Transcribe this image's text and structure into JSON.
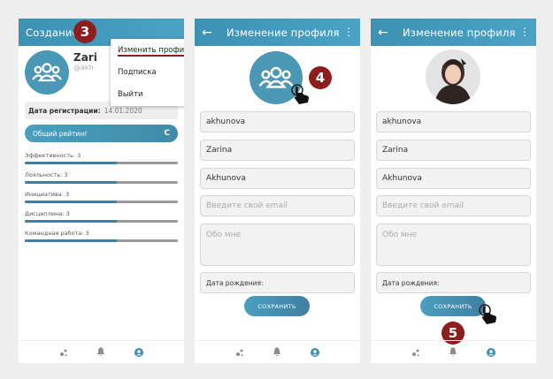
{
  "panel1": {
    "header_title": "Создание",
    "name": "Zari",
    "handle": "@akh",
    "reg_label": "Дата регистрации:",
    "reg_value": "14.01.2020",
    "rating_label": "Общий рейтинг",
    "rating_grade": "C",
    "metrics": [
      {
        "label": "Эффективность: 3",
        "value": 0.6
      },
      {
        "label": "Лояльность: 3",
        "value": 0.6
      },
      {
        "label": "Инициатива: 3",
        "value": 0.6
      },
      {
        "label": "Дисциплина: 3",
        "value": 0.6
      },
      {
        "label": "Командная работа: 3",
        "value": 0.6
      }
    ],
    "menu": [
      "Изменить профиль",
      "Подписка",
      "Выйти"
    ],
    "step_badge": "3"
  },
  "panel2": {
    "header_title": "Изменение профиля",
    "fields": {
      "login": "akhunova",
      "first_name": "Zarina",
      "last_name": "Akhunova"
    },
    "email_placeholder": "Введите свой email",
    "about_placeholder": "Обо мне",
    "birth_label": "Дата рождения:",
    "save_label": "СОХРАНИТЬ",
    "step_badge": "4"
  },
  "panel3": {
    "header_title": "Изменение профиля",
    "fields": {
      "login": "akhunova",
      "first_name": "Zarina",
      "last_name": "Akhunova"
    },
    "email_placeholder": "Введите свой email",
    "about_placeholder": "Обо мне",
    "birth_label": "Дата рождения:",
    "save_label": "СОХРАНИТЬ",
    "step_badge": "5"
  },
  "icons": {
    "back": "arrow-left-icon",
    "more": "kebab-menu-icon",
    "avatar": "group-icon",
    "nav": [
      "dots-icon",
      "bell-icon",
      "user-icon"
    ]
  },
  "colors": {
    "accent": "#3d92b4",
    "badge": "#8e1d1d"
  }
}
